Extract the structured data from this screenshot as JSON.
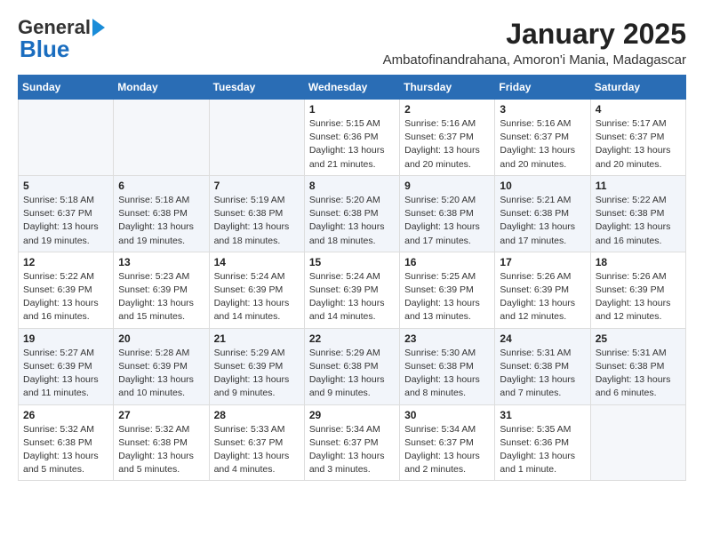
{
  "header": {
    "logo_general": "General",
    "logo_blue": "Blue",
    "month_title": "January 2025",
    "location": "Ambatofinandrahana, Amoron'i Mania, Madagascar"
  },
  "columns": [
    "Sunday",
    "Monday",
    "Tuesday",
    "Wednesday",
    "Thursday",
    "Friday",
    "Saturday"
  ],
  "weeks": [
    [
      {
        "day": "",
        "info": ""
      },
      {
        "day": "",
        "info": ""
      },
      {
        "day": "",
        "info": ""
      },
      {
        "day": "1",
        "info": "Sunrise: 5:15 AM\nSunset: 6:36 PM\nDaylight: 13 hours\nand 21 minutes."
      },
      {
        "day": "2",
        "info": "Sunrise: 5:16 AM\nSunset: 6:37 PM\nDaylight: 13 hours\nand 20 minutes."
      },
      {
        "day": "3",
        "info": "Sunrise: 5:16 AM\nSunset: 6:37 PM\nDaylight: 13 hours\nand 20 minutes."
      },
      {
        "day": "4",
        "info": "Sunrise: 5:17 AM\nSunset: 6:37 PM\nDaylight: 13 hours\nand 20 minutes."
      }
    ],
    [
      {
        "day": "5",
        "info": "Sunrise: 5:18 AM\nSunset: 6:37 PM\nDaylight: 13 hours\nand 19 minutes."
      },
      {
        "day": "6",
        "info": "Sunrise: 5:18 AM\nSunset: 6:38 PM\nDaylight: 13 hours\nand 19 minutes."
      },
      {
        "day": "7",
        "info": "Sunrise: 5:19 AM\nSunset: 6:38 PM\nDaylight: 13 hours\nand 18 minutes."
      },
      {
        "day": "8",
        "info": "Sunrise: 5:20 AM\nSunset: 6:38 PM\nDaylight: 13 hours\nand 18 minutes."
      },
      {
        "day": "9",
        "info": "Sunrise: 5:20 AM\nSunset: 6:38 PM\nDaylight: 13 hours\nand 17 minutes."
      },
      {
        "day": "10",
        "info": "Sunrise: 5:21 AM\nSunset: 6:38 PM\nDaylight: 13 hours\nand 17 minutes."
      },
      {
        "day": "11",
        "info": "Sunrise: 5:22 AM\nSunset: 6:38 PM\nDaylight: 13 hours\nand 16 minutes."
      }
    ],
    [
      {
        "day": "12",
        "info": "Sunrise: 5:22 AM\nSunset: 6:39 PM\nDaylight: 13 hours\nand 16 minutes."
      },
      {
        "day": "13",
        "info": "Sunrise: 5:23 AM\nSunset: 6:39 PM\nDaylight: 13 hours\nand 15 minutes."
      },
      {
        "day": "14",
        "info": "Sunrise: 5:24 AM\nSunset: 6:39 PM\nDaylight: 13 hours\nand 14 minutes."
      },
      {
        "day": "15",
        "info": "Sunrise: 5:24 AM\nSunset: 6:39 PM\nDaylight: 13 hours\nand 14 minutes."
      },
      {
        "day": "16",
        "info": "Sunrise: 5:25 AM\nSunset: 6:39 PM\nDaylight: 13 hours\nand 13 minutes."
      },
      {
        "day": "17",
        "info": "Sunrise: 5:26 AM\nSunset: 6:39 PM\nDaylight: 13 hours\nand 12 minutes."
      },
      {
        "day": "18",
        "info": "Sunrise: 5:26 AM\nSunset: 6:39 PM\nDaylight: 13 hours\nand 12 minutes."
      }
    ],
    [
      {
        "day": "19",
        "info": "Sunrise: 5:27 AM\nSunset: 6:39 PM\nDaylight: 13 hours\nand 11 minutes."
      },
      {
        "day": "20",
        "info": "Sunrise: 5:28 AM\nSunset: 6:39 PM\nDaylight: 13 hours\nand 10 minutes."
      },
      {
        "day": "21",
        "info": "Sunrise: 5:29 AM\nSunset: 6:39 PM\nDaylight: 13 hours\nand 9 minutes."
      },
      {
        "day": "22",
        "info": "Sunrise: 5:29 AM\nSunset: 6:38 PM\nDaylight: 13 hours\nand 9 minutes."
      },
      {
        "day": "23",
        "info": "Sunrise: 5:30 AM\nSunset: 6:38 PM\nDaylight: 13 hours\nand 8 minutes."
      },
      {
        "day": "24",
        "info": "Sunrise: 5:31 AM\nSunset: 6:38 PM\nDaylight: 13 hours\nand 7 minutes."
      },
      {
        "day": "25",
        "info": "Sunrise: 5:31 AM\nSunset: 6:38 PM\nDaylight: 13 hours\nand 6 minutes."
      }
    ],
    [
      {
        "day": "26",
        "info": "Sunrise: 5:32 AM\nSunset: 6:38 PM\nDaylight: 13 hours\nand 5 minutes."
      },
      {
        "day": "27",
        "info": "Sunrise: 5:32 AM\nSunset: 6:38 PM\nDaylight: 13 hours\nand 5 minutes."
      },
      {
        "day": "28",
        "info": "Sunrise: 5:33 AM\nSunset: 6:37 PM\nDaylight: 13 hours\nand 4 minutes."
      },
      {
        "day": "29",
        "info": "Sunrise: 5:34 AM\nSunset: 6:37 PM\nDaylight: 13 hours\nand 3 minutes."
      },
      {
        "day": "30",
        "info": "Sunrise: 5:34 AM\nSunset: 6:37 PM\nDaylight: 13 hours\nand 2 minutes."
      },
      {
        "day": "31",
        "info": "Sunrise: 5:35 AM\nSunset: 6:36 PM\nDaylight: 13 hours\nand 1 minute."
      },
      {
        "day": "",
        "info": ""
      }
    ]
  ]
}
